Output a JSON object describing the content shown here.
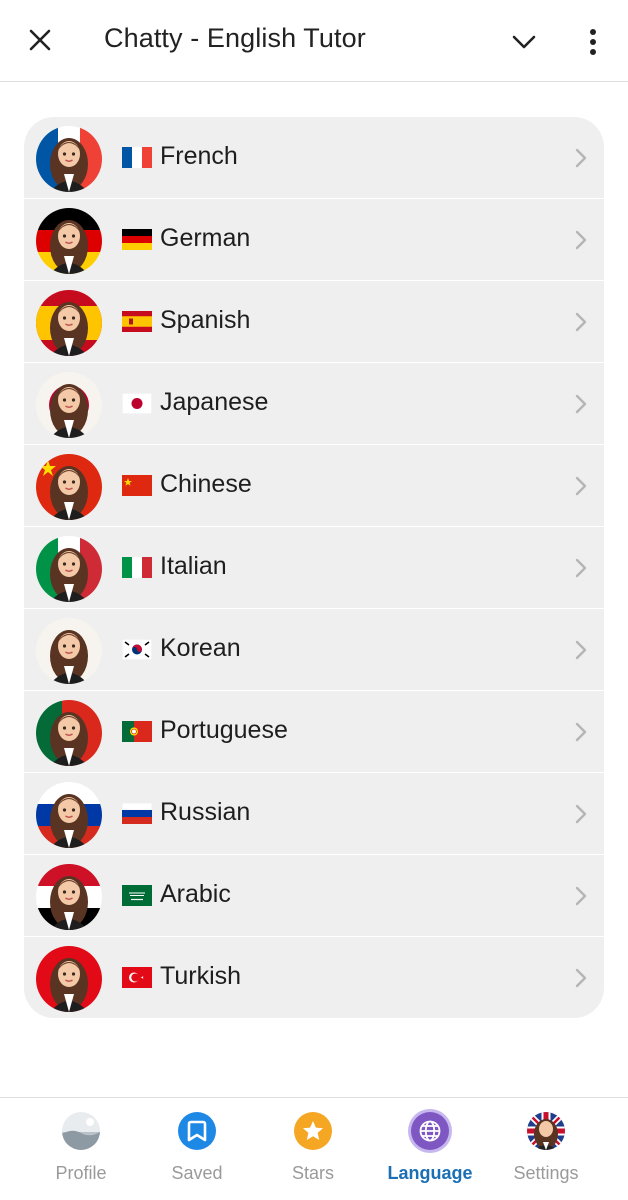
{
  "header": {
    "title": "Chatty - English Tutor"
  },
  "languages": [
    {
      "name": "French",
      "flag": "fr",
      "flag_icon": "flag-france-icon"
    },
    {
      "name": "German",
      "flag": "de",
      "flag_icon": "flag-germany-icon"
    },
    {
      "name": "Spanish",
      "flag": "es",
      "flag_icon": "flag-spain-icon"
    },
    {
      "name": "Japanese",
      "flag": "jp",
      "flag_icon": "flag-japan-icon"
    },
    {
      "name": "Chinese",
      "flag": "cn",
      "flag_icon": "flag-china-icon"
    },
    {
      "name": "Italian",
      "flag": "it",
      "flag_icon": "flag-italy-icon"
    },
    {
      "name": "Korean",
      "flag": "kr",
      "flag_icon": "flag-korea-icon"
    },
    {
      "name": "Portuguese",
      "flag": "pt",
      "flag_icon": "flag-portugal-icon"
    },
    {
      "name": "Russian",
      "flag": "ru",
      "flag_icon": "flag-russia-icon"
    },
    {
      "name": "Arabic",
      "flag": "sa",
      "flag_icon": "flag-saudi-arabia-icon"
    },
    {
      "name": "Turkish",
      "flag": "tr",
      "flag_icon": "flag-turkey-icon"
    }
  ],
  "nav": {
    "active": "Language",
    "tabs": [
      {
        "label": "Profile",
        "icon": "profile-photo-icon"
      },
      {
        "label": "Saved",
        "icon": "bookmark-icon"
      },
      {
        "label": "Stars",
        "icon": "star-icon"
      },
      {
        "label": "Language",
        "icon": "globe-icon"
      },
      {
        "label": "Settings",
        "icon": "tutor-avatar-icon"
      }
    ]
  },
  "colors": {
    "accent": "#1a6fb5",
    "inactive_tab": "#9a9a9a",
    "list_bg": "#efefef",
    "saved_blue": "#1e88e5",
    "stars_orange": "#f5a623",
    "language_purple": "#7e57c2"
  }
}
